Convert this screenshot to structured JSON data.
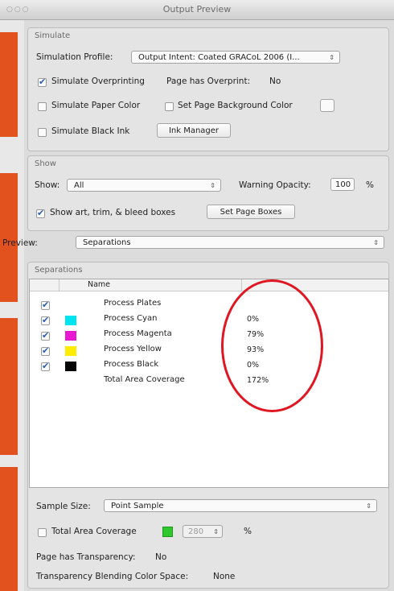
{
  "window": {
    "title": "Output Preview"
  },
  "simulate": {
    "label": "Simulate",
    "profile_label": "Simulation Profile:",
    "profile_value": "Output Intent: Coated GRACoL 2006 (I...",
    "overprinting_label": "Simulate Overprinting",
    "overprinting_checked": true,
    "page_has_overprint_label": "Page has Overprint:",
    "page_has_overprint_value": "No",
    "paper_color_label": "Simulate Paper Color",
    "paper_color_checked": false,
    "bg_color_label": "Set Page Background Color",
    "bg_color_checked": false,
    "black_ink_label": "Simulate Black Ink",
    "black_ink_checked": false,
    "ink_manager_label": "Ink Manager"
  },
  "show": {
    "label": "Show",
    "show_label": "Show:",
    "show_value": "All",
    "warning_label": "Warning Opacity:",
    "warning_value": "100",
    "warning_unit": "%",
    "boxes_label": "Show art, trim, & bleed boxes",
    "boxes_checked": true,
    "page_boxes_button": "Set Page Boxes"
  },
  "preview": {
    "label": "Preview:",
    "value": "Separations"
  },
  "separations": {
    "label": "Separations",
    "name_header": "Name",
    "rows": [
      {
        "checked": true,
        "color": "",
        "name": "Process Plates",
        "value": ""
      },
      {
        "checked": true,
        "color": "#00e5f0",
        "name": "Process Cyan",
        "value": "0%"
      },
      {
        "checked": true,
        "color": "#e81ad2",
        "name": "Process Magenta",
        "value": "79%"
      },
      {
        "checked": true,
        "color": "#ffec00",
        "name": "Process Yellow",
        "value": "93%"
      },
      {
        "checked": true,
        "color": "#000000",
        "name": "Process Black",
        "value": "0%"
      },
      {
        "checked": false,
        "color": "",
        "name": "Total Area Coverage",
        "value": "172%"
      }
    ]
  },
  "sample": {
    "label": "Sample Size:",
    "value": "Point Sample"
  },
  "coverage": {
    "label": "Total Area Coverage",
    "checked": false,
    "swatch_color": "#2ec82e",
    "value": "280",
    "unit": "%"
  },
  "transparency": {
    "label": "Page has Transparency:",
    "value": "No",
    "blend_label": "Transparency Blending Color Space:",
    "blend_value": "None"
  },
  "annotation_color": "#e01722"
}
